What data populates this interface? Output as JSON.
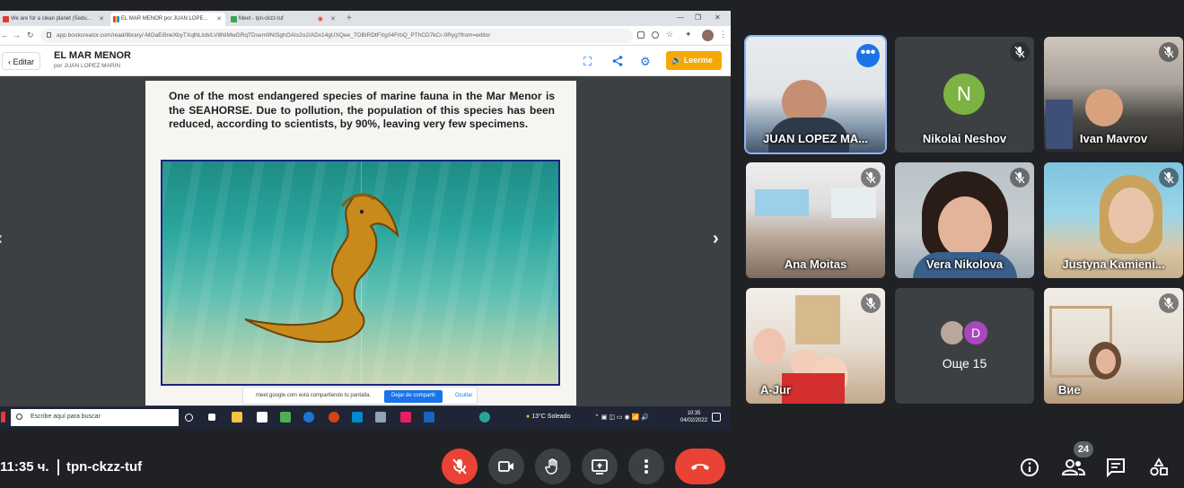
{
  "browser": {
    "tabs": [
      {
        "title": "We are for a clean planet (Sedu..."
      },
      {
        "title": "EL MAR MENOR por JUAN LOPE..."
      },
      {
        "title": "Meet - tpn-ckzz-tuf"
      }
    ],
    "url": "app.bookcreator.com/read/library/-MOaEi9neXbyTXqlhLlob/LV8NIMwGRqTDsem9NISghOAIx2o2/ADx14gUXQee_7OBIRDtFXg/I4FrbQ_PThCD7kCr-0Ryg?from=editor"
  },
  "book": {
    "edit_label": "Editar",
    "title": "EL MAR MENOR",
    "author": "por JUAN LOPEZ MARIN",
    "read_label": "Leerme",
    "page_text": "One of the most endangered species of marine fauna in the Mar Menor is the SEAHORSE. Due to pollution, the population of this species has been reduced, according to scientists, by 90%, leaving very few specimens."
  },
  "share_notice": {
    "message": "meet.google.com está compartiendo tu pantalla.",
    "stop_label": "Dejar de compartir",
    "hide_label": "Ocultar"
  },
  "windows_taskbar": {
    "search_placeholder": "Escribe aquí para buscar",
    "weather": "13°C  Soleado",
    "time": "10:35",
    "date": "04/02/2022"
  },
  "participants": [
    {
      "name": "JUAN LOPEZ MA...",
      "muted": false,
      "active": true
    },
    {
      "name": "Nikolai Neshov",
      "initial": "N",
      "muted": true
    },
    {
      "name": "Ivan Mavrov",
      "muted": true
    },
    {
      "name": "Ana Moitas",
      "muted": true
    },
    {
      "name": "Vera Nikolova",
      "muted": true
    },
    {
      "name": "Justyna Kamieni...",
      "muted": true
    },
    {
      "name": "A-Jur",
      "muted": true
    },
    {
      "name": "Още 15",
      "initial": "D",
      "muted": false
    },
    {
      "name": "Вие",
      "muted": true
    }
  ],
  "meeting": {
    "time": "11:35 ч.",
    "code": "tpn-ckzz-tuf",
    "participant_count": "24"
  }
}
